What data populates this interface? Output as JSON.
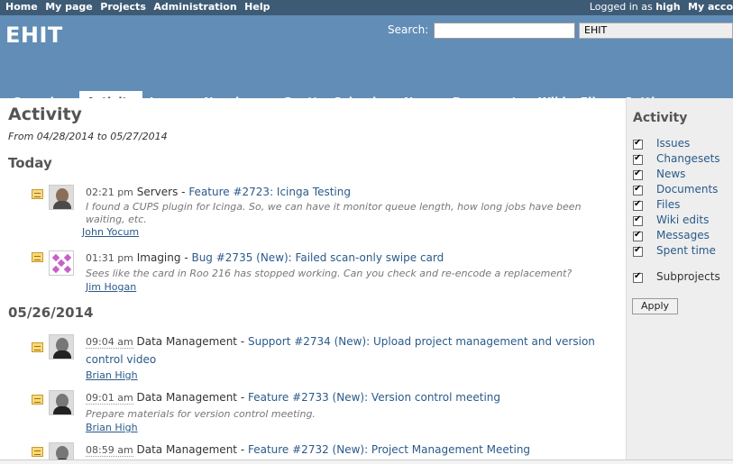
{
  "top_menu": {
    "links": [
      "Home",
      "My page",
      "Projects",
      "Administration",
      "Help"
    ],
    "logged_in_prefix": "Logged in as",
    "username": "high",
    "my_account": "My acco"
  },
  "header": {
    "project_title": "EHIT",
    "search_label": "Search:",
    "search_value": "",
    "project_jump_value": "EHIT"
  },
  "main_menu": {
    "tabs": [
      "Overview",
      "Activity",
      "Issues",
      "New issue",
      "Gantt",
      "Calendar",
      "News",
      "Documents",
      "Wiki",
      "Files",
      "Settings"
    ],
    "selected": "Activity"
  },
  "activity": {
    "title": "Activity",
    "range": "From 04/28/2014 to 05/27/2014",
    "days": [
      {
        "heading": "Today",
        "events": [
          {
            "time": "02:21 pm",
            "project": "Servers",
            "title": "Feature #2723: Icinga Testing",
            "description": "I found a CUPS plugin for Icinga. So, we can have it monitor queue length, how long jobs have been waiting, etc.",
            "author": "John Yocum",
            "icon": "comment-icon"
          },
          {
            "time": "01:31 pm",
            "project": "Imaging",
            "title": "Bug #2735 (New): Failed scan-only swipe card",
            "description": "Sees like the card in Roo 216 has stopped working. Can you check and re-encode a replacement?",
            "author": "Jim Hogan",
            "icon": "issue-icon"
          }
        ]
      },
      {
        "heading": "05/26/2014",
        "events": [
          {
            "time": "09:04 am",
            "project": "Data Management",
            "title": "Support #2734 (New): Upload project management and version control video",
            "title_line1": "Support #2734 (New): Upload project management and version",
            "title_line2": "control video",
            "description": "",
            "author": "Brian High",
            "icon": "issue-icon"
          },
          {
            "time": "09:01 am",
            "project": "Data Management",
            "title": "Feature #2733 (New): Version control meeting",
            "description": "Prepare materials for version control meeting.",
            "author": "Brian High",
            "icon": "issue-icon"
          },
          {
            "time": "08:59 am",
            "project": "Data Management",
            "title": "Feature #2732 (New): Project Management Meeting",
            "description": "",
            "author": "",
            "icon": "issue-icon"
          }
        ]
      }
    ]
  },
  "sidebar": {
    "title": "Activity",
    "filters": [
      {
        "label": "Issues",
        "checked": true
      },
      {
        "label": "Changesets",
        "checked": true
      },
      {
        "label": "News",
        "checked": true
      },
      {
        "label": "Documents",
        "checked": true
      },
      {
        "label": "Files",
        "checked": true
      },
      {
        "label": "Wiki edits",
        "checked": true
      },
      {
        "label": "Messages",
        "checked": true
      },
      {
        "label": "Spent time",
        "checked": true
      }
    ],
    "subprojects_label": "Subprojects",
    "subprojects_checked": true,
    "apply_label": "Apply"
  },
  "colors": {
    "top_menu_bg": "#3E5B76",
    "header_bg": "#628DB6",
    "link": "#2A5A8A",
    "sidebar_bg": "#EEEEEE"
  }
}
